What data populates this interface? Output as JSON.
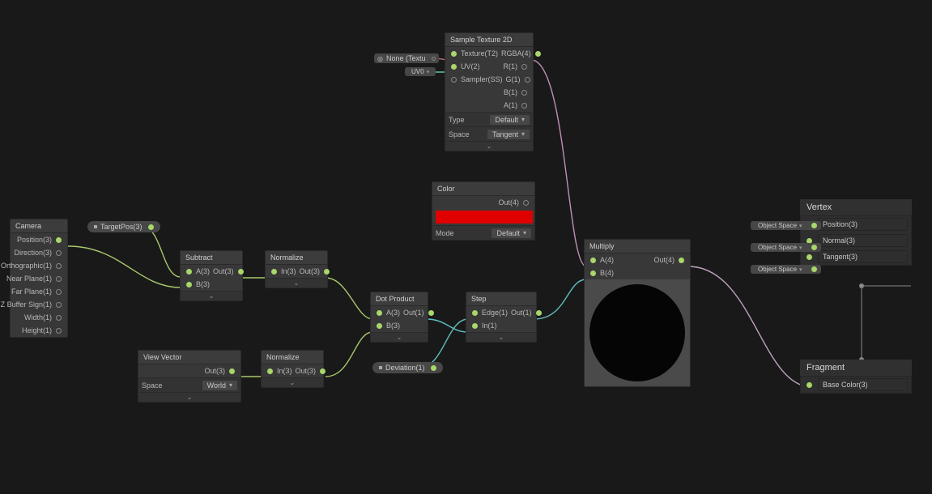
{
  "camera": {
    "title": "Camera",
    "outputs": [
      "Position(3)",
      "Direction(3)",
      "Orthographic(1)",
      "Near Plane(1)",
      "Far Plane(1)",
      "Z Buffer Sign(1)",
      "Width(1)",
      "Height(1)"
    ]
  },
  "targetPos": {
    "label": "TargetPos(3)"
  },
  "subtract": {
    "title": "Subtract",
    "in": [
      "A(3)",
      "B(3)"
    ],
    "out": "Out(3)"
  },
  "viewVector": {
    "title": "View Vector",
    "out": "Out(3)",
    "propLabel": "Space",
    "propValue": "World"
  },
  "normalize1": {
    "title": "Normalize",
    "in": "In(3)",
    "out": "Out(3)"
  },
  "normalize2": {
    "title": "Normalize",
    "in": "In(3)",
    "out": "Out(3)"
  },
  "dot": {
    "title": "Dot Product",
    "in": [
      "A(3)",
      "B(3)"
    ],
    "out": "Out(1)"
  },
  "deviation": {
    "label": "Deviation(1)"
  },
  "step": {
    "title": "Step",
    "in": [
      "Edge(1)",
      "In(1)"
    ],
    "out": "Out(1)"
  },
  "sampleTex": {
    "title": "Sample Texture 2D",
    "inputs": [
      "Texture(T2)",
      "UV(2)",
      "Sampler(SS)"
    ],
    "outputs": [
      "RGBA(4)",
      "R(1)",
      "G(1)",
      "B(1)",
      "A(1)"
    ],
    "prop1Label": "Type",
    "prop1Value": "Default",
    "prop2Label": "Space",
    "prop2Value": "Tangent",
    "texSlot": "None (Textu",
    "uvSlot": "UV0"
  },
  "color": {
    "title": "Color",
    "out": "Out(4)",
    "propLabel": "Mode",
    "propValue": "Default",
    "hex": "#e00000"
  },
  "multiply": {
    "title": "Multiply",
    "in": [
      "A(4)",
      "B(4)"
    ],
    "out": "Out(4)"
  },
  "master": {
    "vertexTitle": "Vertex",
    "fragmentTitle": "Fragment",
    "vertexSlots": [
      {
        "space": "Object Space",
        "name": "Position(3)"
      },
      {
        "space": "Object Space",
        "name": "Normal(3)"
      },
      {
        "space": "Object Space",
        "name": "Tangent(3)"
      }
    ],
    "fragment": {
      "name": "Base Color(3)"
    }
  }
}
